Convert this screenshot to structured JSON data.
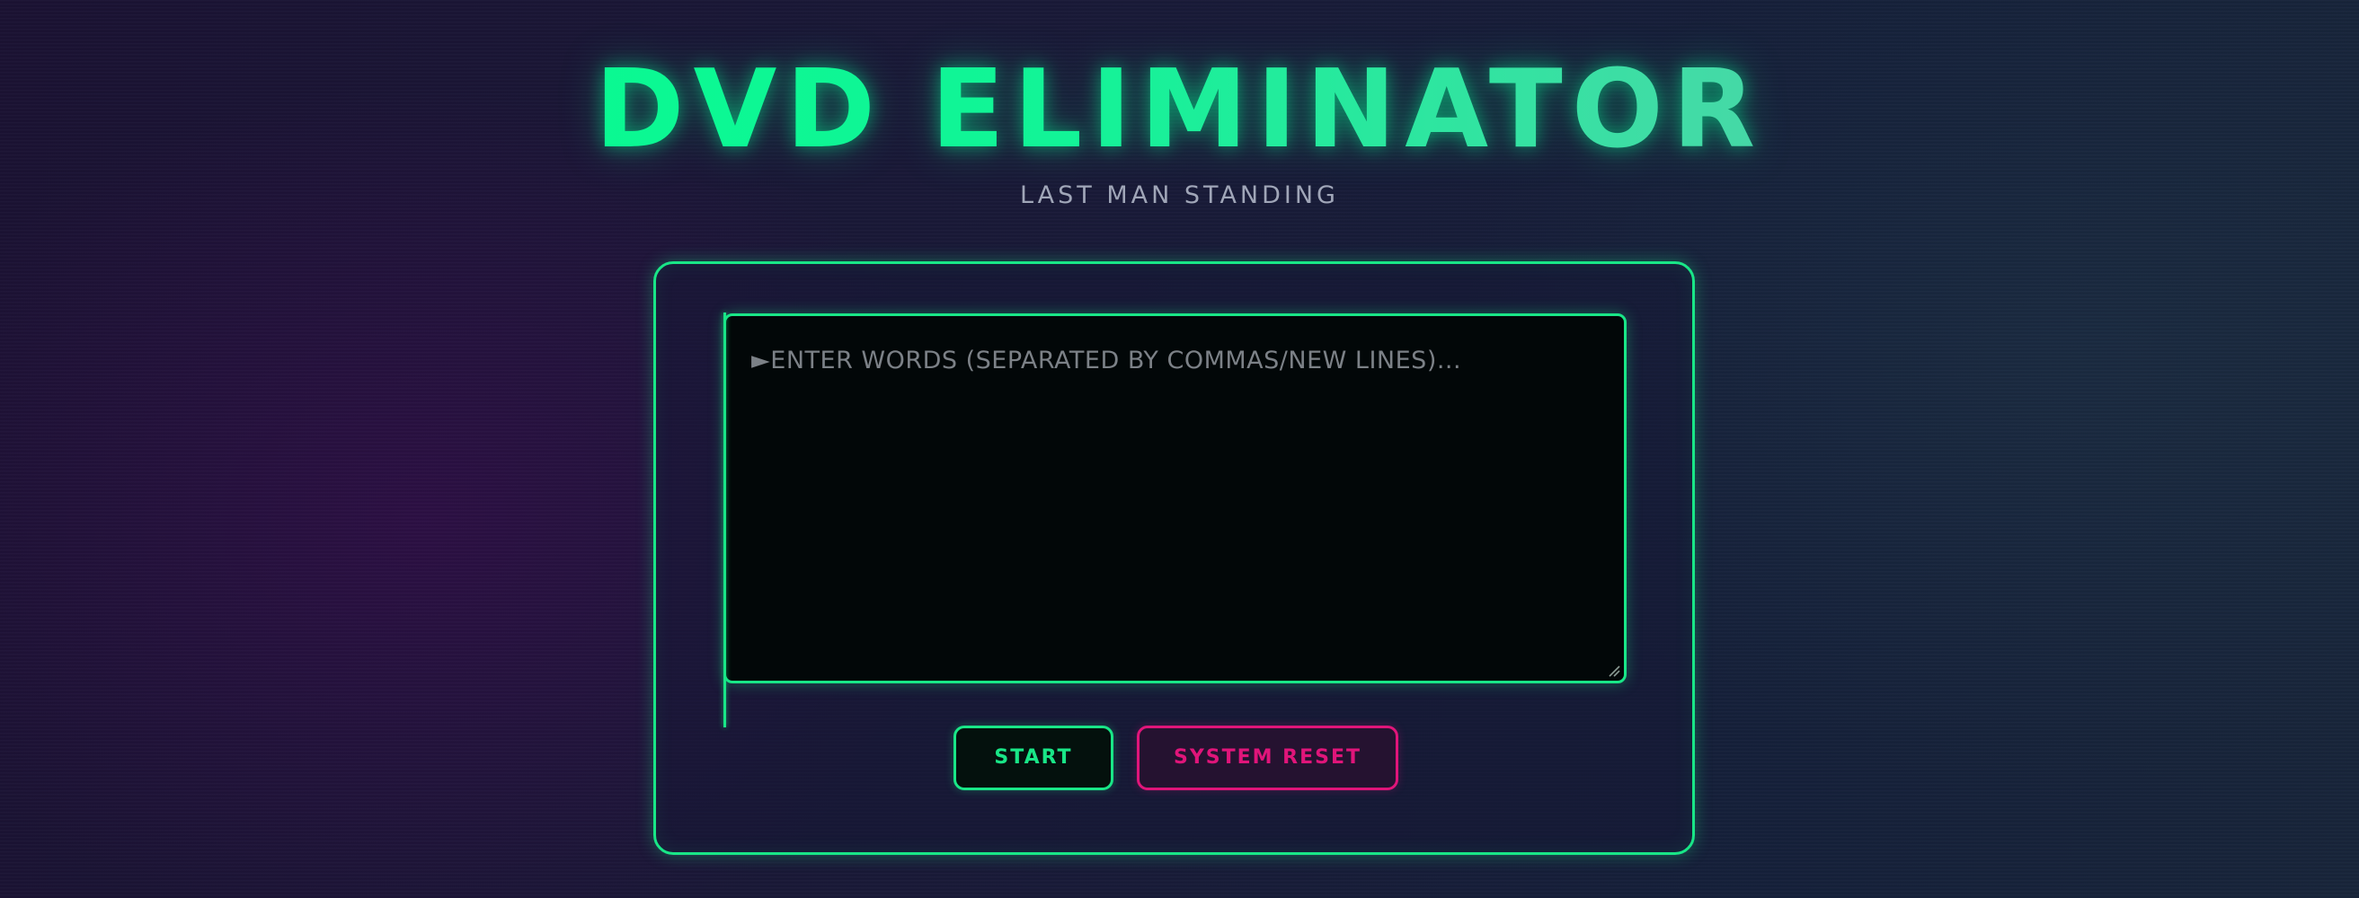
{
  "header": {
    "title": "DVD ELIMINATOR",
    "subtitle": "LAST MAN STANDING"
  },
  "input": {
    "placeholder": "►ENTER WORDS (SEPARATED BY COMMAS/NEW LINES)...",
    "value": ""
  },
  "actions": {
    "start_label": "START",
    "reset_label": "SYSTEM RESET"
  },
  "colors": {
    "accent_green": "#19e687",
    "accent_pink": "#e0157a",
    "subtitle_gray": "#a0a6b8"
  }
}
